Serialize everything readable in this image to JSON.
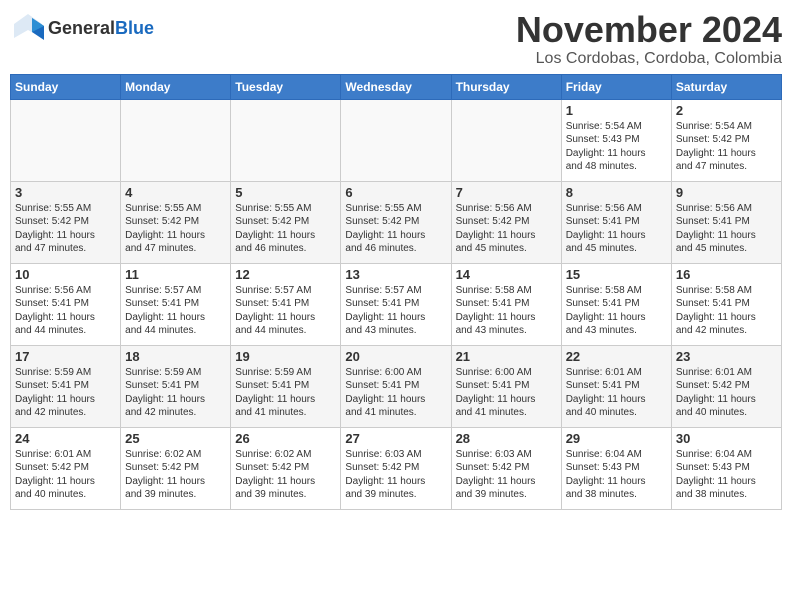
{
  "header": {
    "logo_general": "General",
    "logo_blue": "Blue",
    "month_title": "November 2024",
    "location": "Los Cordobas, Cordoba, Colombia"
  },
  "weekdays": [
    "Sunday",
    "Monday",
    "Tuesday",
    "Wednesday",
    "Thursday",
    "Friday",
    "Saturday"
  ],
  "weeks": [
    [
      {
        "day": "",
        "info": ""
      },
      {
        "day": "",
        "info": ""
      },
      {
        "day": "",
        "info": ""
      },
      {
        "day": "",
        "info": ""
      },
      {
        "day": "",
        "info": ""
      },
      {
        "day": "1",
        "info": "Sunrise: 5:54 AM\nSunset: 5:43 PM\nDaylight: 11 hours\nand 48 minutes."
      },
      {
        "day": "2",
        "info": "Sunrise: 5:54 AM\nSunset: 5:42 PM\nDaylight: 11 hours\nand 47 minutes."
      }
    ],
    [
      {
        "day": "3",
        "info": "Sunrise: 5:55 AM\nSunset: 5:42 PM\nDaylight: 11 hours\nand 47 minutes."
      },
      {
        "day": "4",
        "info": "Sunrise: 5:55 AM\nSunset: 5:42 PM\nDaylight: 11 hours\nand 47 minutes."
      },
      {
        "day": "5",
        "info": "Sunrise: 5:55 AM\nSunset: 5:42 PM\nDaylight: 11 hours\nand 46 minutes."
      },
      {
        "day": "6",
        "info": "Sunrise: 5:55 AM\nSunset: 5:42 PM\nDaylight: 11 hours\nand 46 minutes."
      },
      {
        "day": "7",
        "info": "Sunrise: 5:56 AM\nSunset: 5:42 PM\nDaylight: 11 hours\nand 45 minutes."
      },
      {
        "day": "8",
        "info": "Sunrise: 5:56 AM\nSunset: 5:41 PM\nDaylight: 11 hours\nand 45 minutes."
      },
      {
        "day": "9",
        "info": "Sunrise: 5:56 AM\nSunset: 5:41 PM\nDaylight: 11 hours\nand 45 minutes."
      }
    ],
    [
      {
        "day": "10",
        "info": "Sunrise: 5:56 AM\nSunset: 5:41 PM\nDaylight: 11 hours\nand 44 minutes."
      },
      {
        "day": "11",
        "info": "Sunrise: 5:57 AM\nSunset: 5:41 PM\nDaylight: 11 hours\nand 44 minutes."
      },
      {
        "day": "12",
        "info": "Sunrise: 5:57 AM\nSunset: 5:41 PM\nDaylight: 11 hours\nand 44 minutes."
      },
      {
        "day": "13",
        "info": "Sunrise: 5:57 AM\nSunset: 5:41 PM\nDaylight: 11 hours\nand 43 minutes."
      },
      {
        "day": "14",
        "info": "Sunrise: 5:58 AM\nSunset: 5:41 PM\nDaylight: 11 hours\nand 43 minutes."
      },
      {
        "day": "15",
        "info": "Sunrise: 5:58 AM\nSunset: 5:41 PM\nDaylight: 11 hours\nand 43 minutes."
      },
      {
        "day": "16",
        "info": "Sunrise: 5:58 AM\nSunset: 5:41 PM\nDaylight: 11 hours\nand 42 minutes."
      }
    ],
    [
      {
        "day": "17",
        "info": "Sunrise: 5:59 AM\nSunset: 5:41 PM\nDaylight: 11 hours\nand 42 minutes."
      },
      {
        "day": "18",
        "info": "Sunrise: 5:59 AM\nSunset: 5:41 PM\nDaylight: 11 hours\nand 42 minutes."
      },
      {
        "day": "19",
        "info": "Sunrise: 5:59 AM\nSunset: 5:41 PM\nDaylight: 11 hours\nand 41 minutes."
      },
      {
        "day": "20",
        "info": "Sunrise: 6:00 AM\nSunset: 5:41 PM\nDaylight: 11 hours\nand 41 minutes."
      },
      {
        "day": "21",
        "info": "Sunrise: 6:00 AM\nSunset: 5:41 PM\nDaylight: 11 hours\nand 41 minutes."
      },
      {
        "day": "22",
        "info": "Sunrise: 6:01 AM\nSunset: 5:41 PM\nDaylight: 11 hours\nand 40 minutes."
      },
      {
        "day": "23",
        "info": "Sunrise: 6:01 AM\nSunset: 5:42 PM\nDaylight: 11 hours\nand 40 minutes."
      }
    ],
    [
      {
        "day": "24",
        "info": "Sunrise: 6:01 AM\nSunset: 5:42 PM\nDaylight: 11 hours\nand 40 minutes."
      },
      {
        "day": "25",
        "info": "Sunrise: 6:02 AM\nSunset: 5:42 PM\nDaylight: 11 hours\nand 39 minutes."
      },
      {
        "day": "26",
        "info": "Sunrise: 6:02 AM\nSunset: 5:42 PM\nDaylight: 11 hours\nand 39 minutes."
      },
      {
        "day": "27",
        "info": "Sunrise: 6:03 AM\nSunset: 5:42 PM\nDaylight: 11 hours\nand 39 minutes."
      },
      {
        "day": "28",
        "info": "Sunrise: 6:03 AM\nSunset: 5:42 PM\nDaylight: 11 hours\nand 39 minutes."
      },
      {
        "day": "29",
        "info": "Sunrise: 6:04 AM\nSunset: 5:43 PM\nDaylight: 11 hours\nand 38 minutes."
      },
      {
        "day": "30",
        "info": "Sunrise: 6:04 AM\nSunset: 5:43 PM\nDaylight: 11 hours\nand 38 minutes."
      }
    ]
  ]
}
